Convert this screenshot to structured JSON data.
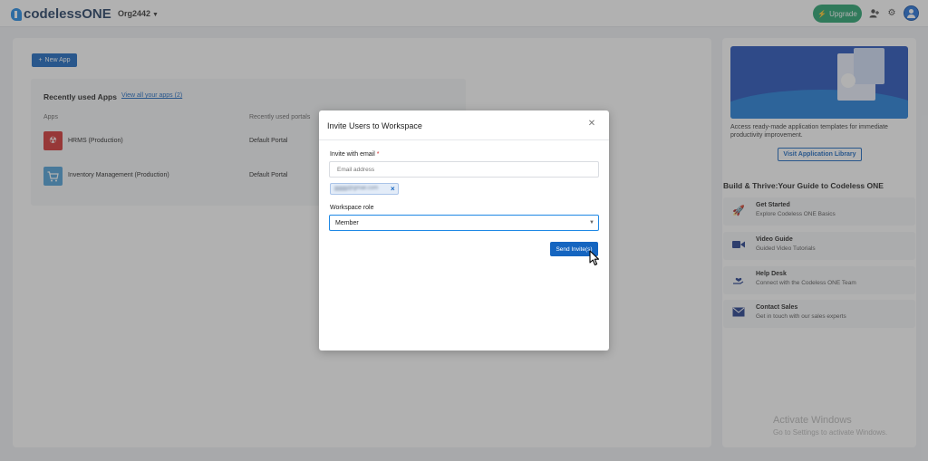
{
  "brand": {
    "logo_text": "codelessONE"
  },
  "header": {
    "org_name": "Org2442",
    "upgrade_label": "Upgrade",
    "icons": [
      "add-user-icon",
      "gear-icon",
      "avatar-icon"
    ]
  },
  "main": {
    "new_app_label": "New App",
    "recent": {
      "title": "Recently used Apps",
      "view_all_link": "View all your apps (2)",
      "col_apps": "Apps",
      "col_portals": "Recently used portals",
      "apps": [
        {
          "name": "HRMS (Production)",
          "portal": "Default Portal",
          "color": "#d32f2f",
          "icon": "radiation-icon"
        },
        {
          "name": "Inventory Management (Production)",
          "portal": "Default Portal",
          "color": "#4a9fd8",
          "icon": "cart-icon"
        }
      ]
    }
  },
  "sidebar": {
    "banner_text": "Access ready-made application templates for immediate productivity improvement.",
    "library_button": "Visit Application Library",
    "guide_title": "Build & Thrive:Your Guide to Codeless ONE",
    "guides": [
      {
        "title": "Get Started",
        "subtitle": "Explore Codeless ONE Basics",
        "icon": "rocket-icon"
      },
      {
        "title": "Video Guide",
        "subtitle": "Guided Video Tutorials",
        "icon": "video-icon"
      },
      {
        "title": "Help Desk",
        "subtitle": "Connect with the Codeless ONE Team",
        "icon": "help-hand-icon"
      },
      {
        "title": "Contact Sales",
        "subtitle": "Get in touch with our sales experts",
        "icon": "mail-icon"
      }
    ]
  },
  "watermark": {
    "title": "Activate Windows",
    "subtitle": "Go to Settings to activate Windows."
  },
  "modal": {
    "title": "Invite Users to Workspace",
    "email_label": "Invite with email",
    "email_required_mark": "*",
    "email_placeholder": "Email address",
    "email_chip": "jjjjjjjjjjj@gmail.com",
    "role_label": "Workspace role",
    "role_value": "Member",
    "send_label": "Send Invite(s)"
  },
  "colors": {
    "primary": "#1565c0",
    "upgrade": "#22a06b",
    "overlay": "rgba(70,70,70,0.42)"
  }
}
